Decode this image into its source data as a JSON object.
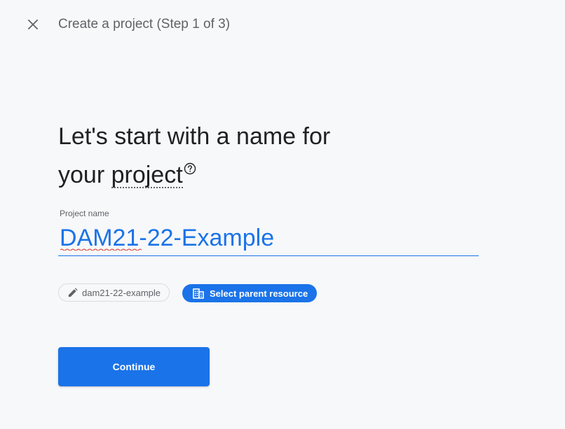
{
  "header": {
    "title": "Create a project (Step 1 of 3)",
    "close_icon": "close-icon"
  },
  "main": {
    "heading_part1": "Let's start with a name for",
    "heading_part2": "your ",
    "heading_project_word": "project",
    "help_icon": "help-circle-icon",
    "field": {
      "label": "Project name",
      "value": "DAM21-22-Example"
    },
    "project_id_chip": {
      "icon": "pencil-icon",
      "label": "dam21-22-example"
    },
    "parent_chip": {
      "icon": "building-icon",
      "label": "Select parent resource"
    },
    "continue_label": "Continue"
  },
  "colors": {
    "accent": "#1a73e8",
    "background": "#f7f8fa",
    "text": "#202124",
    "muted": "#5f6368"
  }
}
